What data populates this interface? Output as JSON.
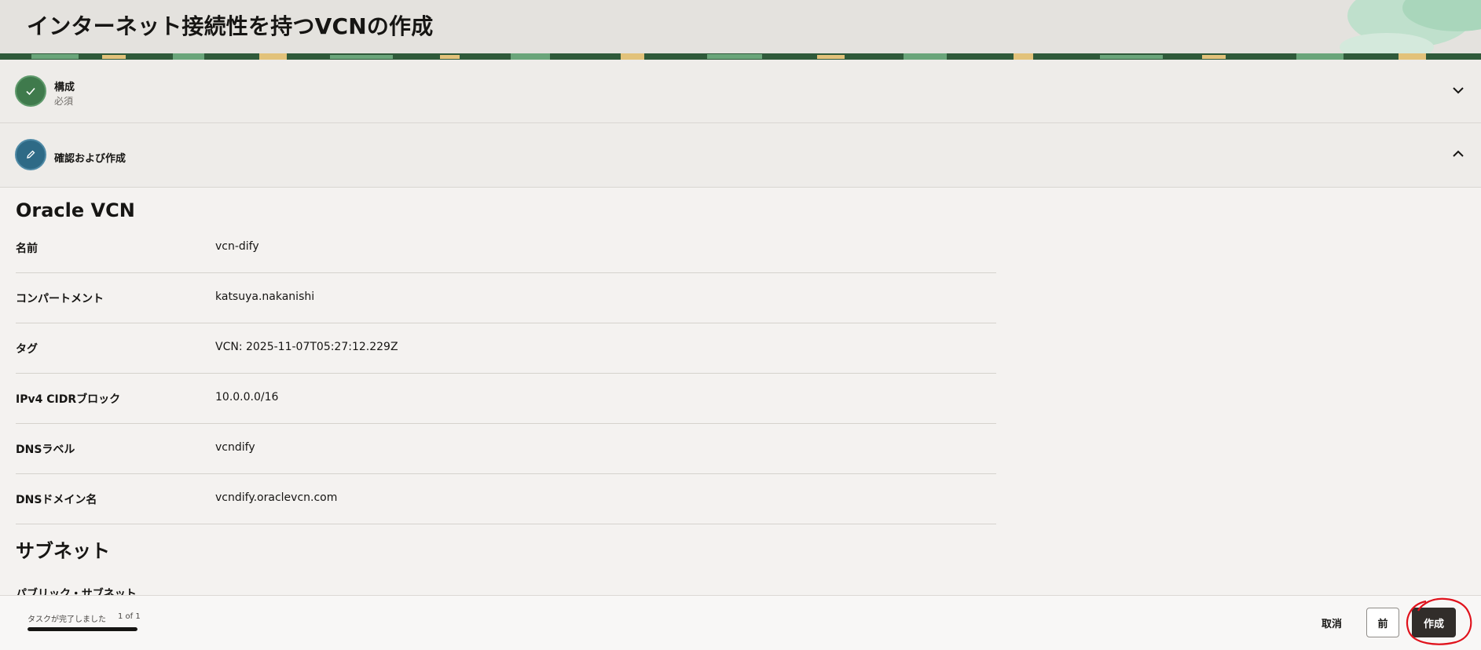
{
  "header": {
    "title": "インターネット接続性を持つVCNの作成"
  },
  "steps": [
    {
      "title": "構成",
      "subtitle": "必須",
      "state": "complete",
      "icon": "check-icon",
      "chevron": "chevron-down-icon"
    },
    {
      "title": "確認および作成",
      "state": "active",
      "icon": "pencil-icon",
      "chevron": "chevron-up-icon"
    }
  ],
  "review": {
    "section_title": "Oracle VCN",
    "rows": [
      {
        "label": "名前",
        "value": "vcn-dify"
      },
      {
        "label": "コンパートメント",
        "value": "katsuya.nakanishi"
      },
      {
        "label": "タグ",
        "value": "VCN: 2025-11-07T05:27:12.229Z"
      },
      {
        "label": "IPv4 CIDRブロック",
        "value": "10.0.0.0/16"
      },
      {
        "label": "DNSラベル",
        "value": "vcndify"
      },
      {
        "label": "DNSドメイン名",
        "value": "vcndify.oraclevcn.com"
      }
    ],
    "subnet_title": "サブネット",
    "subnet_cut_heading": "パブリック・サブネット"
  },
  "footer": {
    "task_status": "タスクが完了しました",
    "task_count": "1 of 1",
    "progress": 1.0,
    "cancel_label": "取消",
    "prev_label": "前",
    "create_label": "作成"
  },
  "colors": {
    "complete_step": "#3f7a4c",
    "active_step": "#2e6a86",
    "primary_button": "#312d2a",
    "annotation": "#e0121c"
  }
}
